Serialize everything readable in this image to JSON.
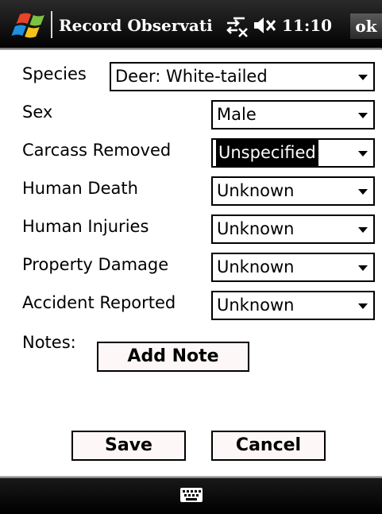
{
  "titlebar": {
    "title": "Record Observati",
    "time": "11:10",
    "ok_label": "ok",
    "start_icon": "windows-flag-icon",
    "connectivity_icon": "connectivity-off-icon",
    "volume_icon": "volume-muted-icon"
  },
  "form": {
    "fields": [
      {
        "label": "Species",
        "value": "Deer: White-tailed"
      },
      {
        "label": "Sex",
        "value": "Male"
      },
      {
        "label": "Carcass Removed",
        "value": "Unspecified"
      },
      {
        "label": "Human Death",
        "value": "Unknown"
      },
      {
        "label": "Human Injuries",
        "value": "Unknown"
      },
      {
        "label": "Property Damage",
        "value": "Unknown"
      },
      {
        "label": "Accident Reported",
        "value": "Unknown"
      }
    ],
    "notes_label": "Notes:",
    "add_note_label": "Add Note"
  },
  "actions": {
    "save_label": "Save",
    "cancel_label": "Cancel"
  },
  "bottombar": {
    "keyboard_icon": "keyboard-icon"
  },
  "colors": {
    "titlebar": "#000000",
    "button_face": "#fdf7f7",
    "selected_value_bg": "#000000"
  }
}
